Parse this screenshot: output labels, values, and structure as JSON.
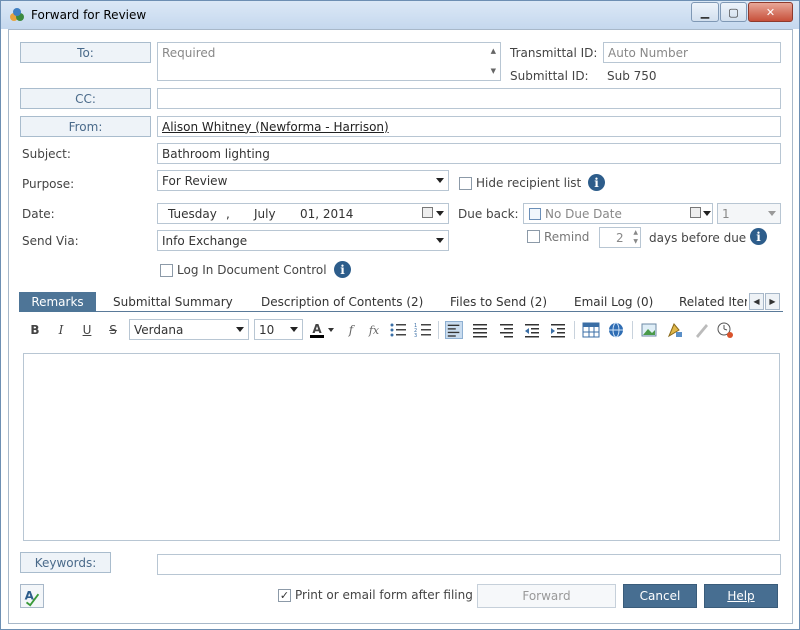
{
  "window": {
    "title": "Forward for Review"
  },
  "header": {
    "to_label": "To:",
    "to_placeholder": "Required",
    "cc_label": "CC:",
    "from_label": "From:",
    "from_value": "Alison Whitney (Newforma - Harrison)",
    "subject_label": "Subject:",
    "subject_value": "Bathroom lighting",
    "purpose_label": "Purpose:",
    "purpose_value": "For Review",
    "date_label": "Date:",
    "date_value": {
      "weekday": "Tuesday",
      "sep": ",",
      "month": "July",
      "day_year": "01, 2014"
    },
    "send_via_label": "Send Via:",
    "send_via_value": "Info Exchange",
    "transmittal_label": "Transmittal ID:",
    "transmittal_placeholder": "Auto Number",
    "submittal_label": "Submittal ID:",
    "submittal_value": "Sub 750",
    "hide_recipient_label": "Hide recipient list",
    "due_back_label": "Due back:",
    "due_back_value": "No Due Date",
    "due_number": "1",
    "remind_label": "Remind",
    "remind_days": "2",
    "days_before_label": "days before due",
    "log_in_label": "Log In Document Control"
  },
  "tabs": [
    {
      "label": "Remarks",
      "active": true
    },
    {
      "label": "Submittal Summary"
    },
    {
      "label": "Description of Contents (2)"
    },
    {
      "label": "Files to Send (2)"
    },
    {
      "label": "Email Log (0)"
    },
    {
      "label": "Related Iter"
    }
  ],
  "toolbar": {
    "bold": "B",
    "italic": "I",
    "underline": "U",
    "strike": "S",
    "font_name": "Verdana",
    "font_size": "10",
    "font_color": "A",
    "formula1": "f",
    "formula2": "fx"
  },
  "footer": {
    "keywords_label": "Keywords:",
    "print_label": "Print or email form after filing",
    "forward_label": "Forward",
    "cancel_label": "Cancel",
    "help_label": "Help"
  },
  "colors": {
    "accent": "#476e91",
    "tab_active": "#4e7597",
    "info": "#2d5d8b"
  }
}
